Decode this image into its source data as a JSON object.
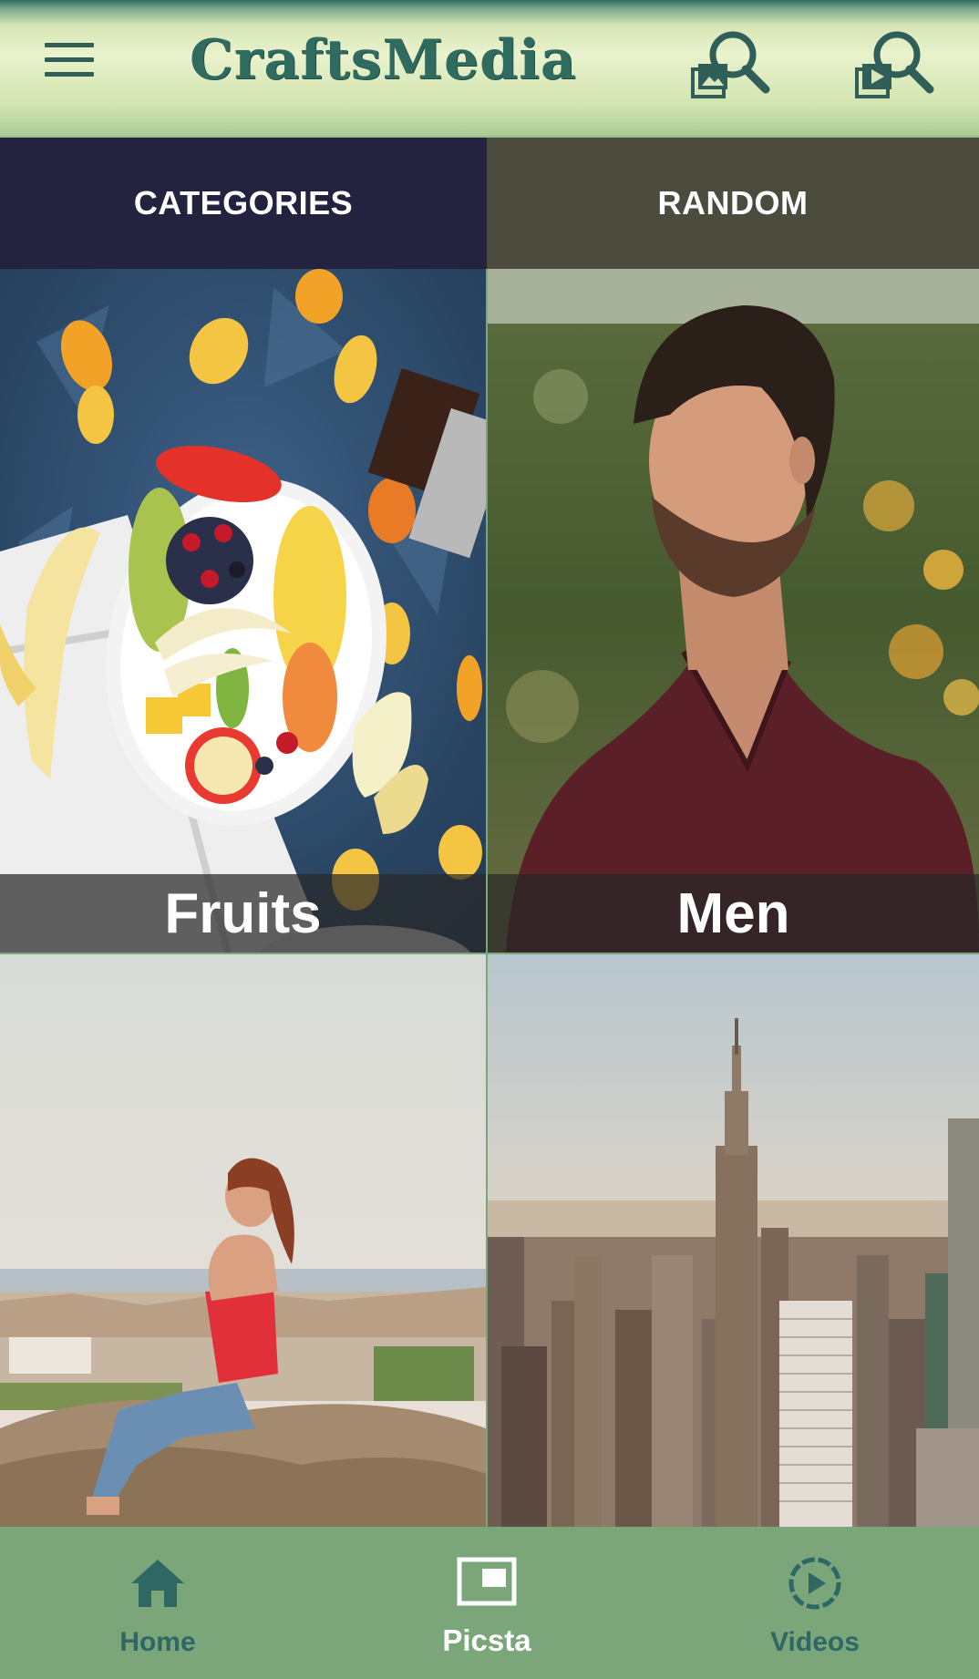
{
  "app": {
    "title": "CraftsMedia",
    "colors": {
      "primary": "#2f6b5f",
      "appbar_light": "#eaf2cc",
      "tab_categories_bg": "#24233f",
      "tab_random_bg": "#4b4c3d",
      "bottom_nav_bg": "#7aa67a",
      "nav_inactive": "#2e6764",
      "nav_active": "#ffffff"
    }
  },
  "appbar": {
    "menu_icon": "hamburger-menu-icon",
    "actions": [
      {
        "icon": "image-search-icon"
      },
      {
        "icon": "video-search-icon"
      }
    ]
  },
  "tabs": [
    {
      "label": "CATEGORIES"
    },
    {
      "label": "RANDOM"
    }
  ],
  "grid": {
    "tiles": [
      {
        "caption": "Fruits",
        "image": "fruit platter on blue background"
      },
      {
        "caption": "Men",
        "image": "bearded man in maroon shirt"
      },
      {
        "caption": "",
        "image": "woman sitting on rock above town"
      },
      {
        "caption": "",
        "image": "city skyline"
      }
    ]
  },
  "bottom_nav": {
    "items": [
      {
        "label": "Home",
        "icon": "home-icon"
      },
      {
        "label": "Picsta",
        "icon": "picture-frame-icon",
        "active": true
      },
      {
        "label": "Videos",
        "icon": "play-circle-icon"
      }
    ]
  }
}
